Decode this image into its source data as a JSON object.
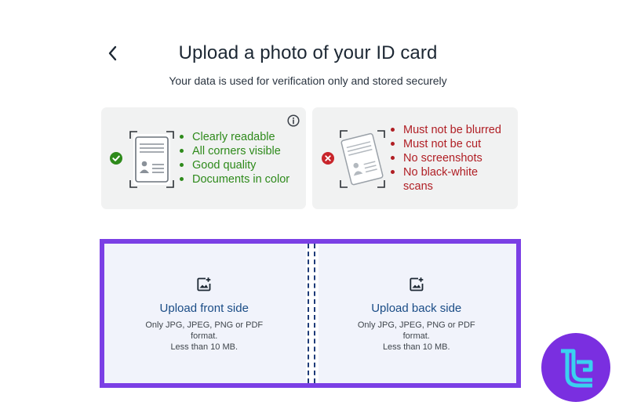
{
  "header": {
    "title": "Upload a photo of your ID card",
    "subtitle": "Your data is used for verification only and stored securely"
  },
  "guidelines": {
    "good": [
      "Clearly readable",
      "All corners visible",
      "Good quality",
      "Documents in color"
    ],
    "bad": [
      "Must not be blurred",
      "Must not be cut",
      "No screenshots",
      "No black-white scans"
    ]
  },
  "upload": {
    "front_label": "Upload front side",
    "back_label": "Upload back side",
    "hint_line1": "Only JPG, JPEG, PNG or PDF format.",
    "hint_line2": "Less than 10 MB."
  },
  "colors": {
    "accent_border": "#7b3fe5",
    "good": "#2e8a1b",
    "bad": "#b01e24",
    "link": "#1a4c86",
    "logo_bg": "#7a2fe0",
    "logo_fg": "#3ad1f0"
  },
  "icons": [
    "chevron-left-icon",
    "info-icon",
    "check-circle-icon",
    "error-circle-icon",
    "id-card-icon",
    "add-image-icon",
    "brand-logo"
  ]
}
